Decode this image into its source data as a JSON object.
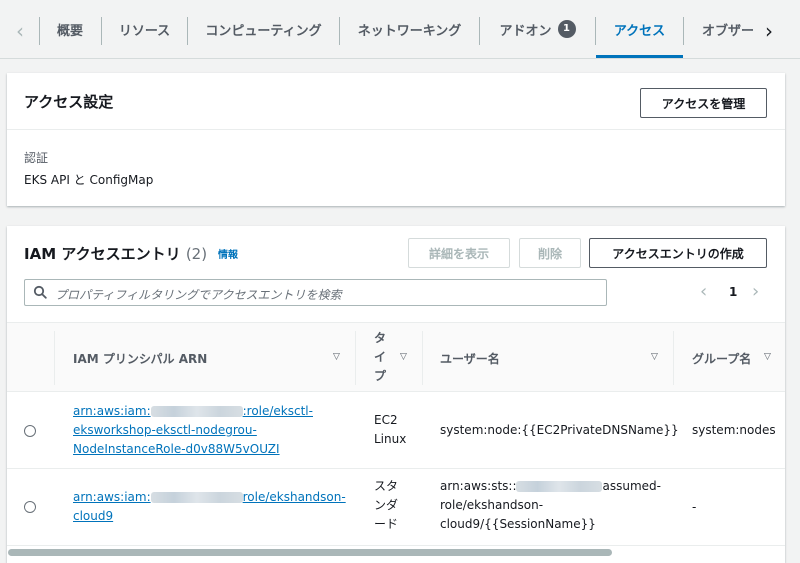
{
  "tabs": {
    "items": [
      {
        "label": "概要"
      },
      {
        "label": "リソース"
      },
      {
        "label": "コンピューティング"
      },
      {
        "label": "ネットワーキング"
      },
      {
        "label": "アドオン",
        "badge": "1"
      },
      {
        "label": "アクセス",
        "active": true
      },
      {
        "label": "オブザー"
      }
    ],
    "prev_icon": "chevron-left-icon",
    "next_icon": "chevron-right-icon"
  },
  "access_settings": {
    "title": "アクセス設定",
    "manage_button": "アクセスを管理",
    "auth_label": "認証",
    "auth_value": "EKS API と ConfigMap"
  },
  "entries": {
    "title": "IAM アクセスエントリ",
    "count": "(2)",
    "info_link": "情報",
    "view_details_button": "詳細を表示",
    "delete_button": "削除",
    "create_button": "アクセスエントリの作成",
    "search_placeholder": "プロパティフィルタリングでアクセスエントリを検索",
    "page": "1",
    "columns": {
      "arn": "IAM プリンシパル ARN",
      "type_line1": "タ",
      "type_line2": "イ",
      "type_line3": "プ",
      "username": "ユーザー名",
      "group": "グループ名"
    },
    "rows": [
      {
        "arn_line1_pre": "arn:aws:iam:",
        "arn_line1_post": ":role/eksctl-",
        "arn_line2": "eksworkshop-eksctl-nodegrou-",
        "arn_line3": "NodeInstanceRole-d0v88W5vOUZI",
        "type_line1": "EC2",
        "type_line2": "Linux",
        "username": "system:node:{{EC2PrivateDNSName}}",
        "group": "system:nodes"
      },
      {
        "arn_line1_pre": "arn:aws:iam:",
        "arn_line1_post": "role/ekshandson-",
        "arn_line2": "cloud9",
        "type_line1": "スタ",
        "type_line2": "ンダ",
        "type_line3": "ード",
        "username_line1_pre": "arn:aws:sts::",
        "username_line1_post": "assumed-",
        "username_line2": "role/ekshandson-",
        "username_line3": "cloud9/{{SessionName}}",
        "group": "-"
      }
    ]
  },
  "colors": {
    "accent": "#0073bb",
    "background": "#f2f3f3",
    "text": "#16191f",
    "muted": "#545b64"
  }
}
